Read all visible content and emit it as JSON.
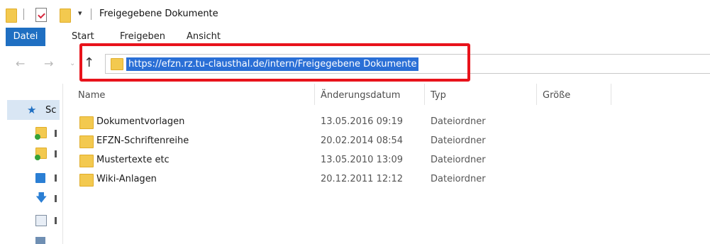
{
  "window": {
    "title": "Freigegebene Dokumente",
    "quick_access_dropdown": "▾"
  },
  "ribbon": {
    "tabs": [
      {
        "label": "Datei",
        "active": true
      },
      {
        "label": "Start"
      },
      {
        "label": "Freigeben"
      },
      {
        "label": "Ansicht"
      }
    ]
  },
  "navigation": {
    "back": "←",
    "forward": "→",
    "recent": "⌄",
    "up": "↑",
    "address": "https://efzn.rz.tu-clausthal.de/intern/Freigegebene Dokumente"
  },
  "nav_pane": {
    "quick_access_label": "Sc"
  },
  "file_list": {
    "columns": [
      "Name",
      "Änderungsdatum",
      "Typ",
      "Größe"
    ],
    "rows": [
      {
        "name": "Dokumentvorlagen",
        "date": "13.05.2016 09:19",
        "type": "Dateiordner"
      },
      {
        "name": "EFZN-Schriftenreihe",
        "date": "20.02.2014 08:54",
        "type": "Dateiordner"
      },
      {
        "name": "Mustertexte etc",
        "date": "13.05.2010 13:09",
        "type": "Dateiordner"
      },
      {
        "name": "Wiki-Anlagen",
        "date": "20.12.2011 12:12",
        "type": "Dateiordner"
      }
    ]
  },
  "colors": {
    "accent": "#1f6fc2",
    "highlight": "#e8131b",
    "folder": "#f3c94f"
  }
}
